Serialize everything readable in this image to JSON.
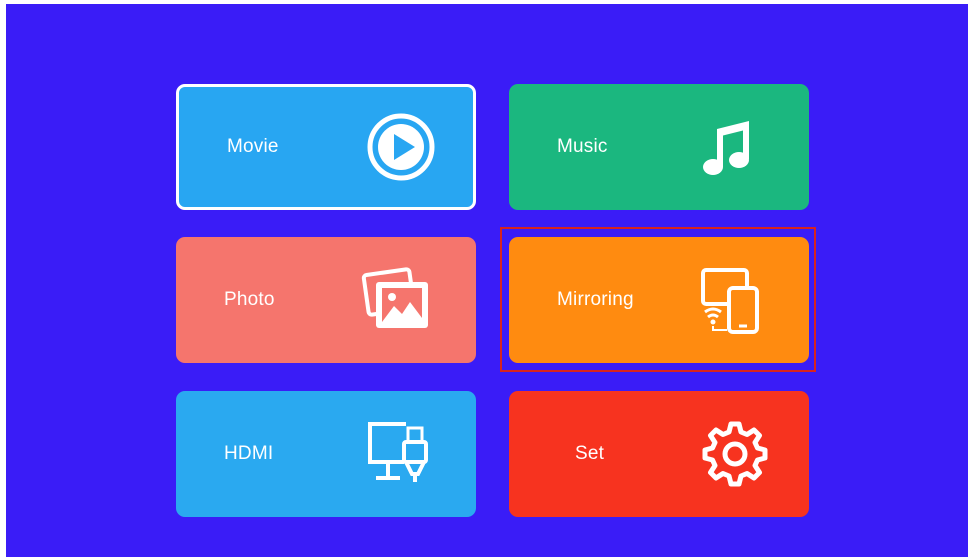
{
  "colors": {
    "background": "#3a1cf7",
    "movie": "#28a6f2",
    "music": "#1bb77f",
    "photo": "#f5756d",
    "mirroring": "#ff8b10",
    "hdmi": "#2aa9f0",
    "set": "#f7331f",
    "focus_border": "#d8241e"
  },
  "menu": {
    "movie": {
      "label": "Movie",
      "icon": "play-circle-icon"
    },
    "music": {
      "label": "Music",
      "icon": "music-note-icon"
    },
    "photo": {
      "label": "Photo",
      "icon": "photo-stack-icon"
    },
    "mirroring": {
      "label": "Mirroring",
      "icon": "screen-mirroring-icon"
    },
    "hdmi": {
      "label": "HDMI",
      "icon": "hdmi-monitor-icon"
    },
    "set": {
      "label": "Set",
      "icon": "gear-icon"
    }
  }
}
